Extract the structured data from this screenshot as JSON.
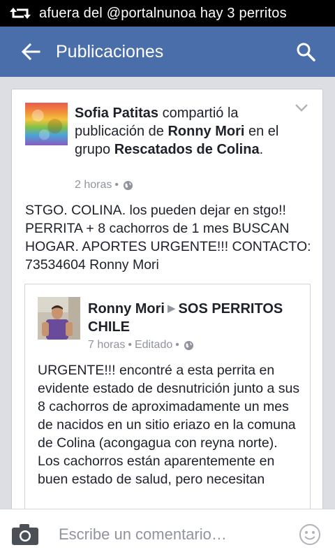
{
  "status_bar": {
    "icon": "retweet-icon",
    "notification_text": "afuera del @portalnunoa hay 3 perritos"
  },
  "app_bar": {
    "title": "Publicaciones",
    "back_icon": "arrow-back-icon",
    "search_icon": "search-icon",
    "color": "#4a6ea9"
  },
  "post": {
    "author": "Sofia Patitas",
    "text_shared": "compartió la publicación de",
    "original_author": "Ronny Mori",
    "text_in_group": "en el grupo",
    "group": "Rescatados de Colina",
    "period": ".",
    "time": "2 horas",
    "dot": "•",
    "body": "STGO. COLINA. los pueden dejar en stgo!! PERRITA + 8 cachorros de 1 mes BUSCAN HOGAR. APORTES URGENTE!!! CONTACTO: 73534604 Ronny Mori"
  },
  "shared_post": {
    "author": "Ronny Mori",
    "arrow": "▶",
    "target": "SOS PERRITOS CHILE",
    "time": "7 horas",
    "edited": "Editado",
    "dot": "•",
    "body": "URGENTE!!! encontré a esta perrita en evidente estado de desnutrición junto a sus 8 cachorros de aproximadamente un mes de nacidos en un sitio eriazo en la comuna de Colina (acongagua con reyna norte).\nLos cachorros están aparentemente en buen estado de salud, pero necesitan"
  },
  "comment_bar": {
    "placeholder": "Escribe un comentario…"
  }
}
